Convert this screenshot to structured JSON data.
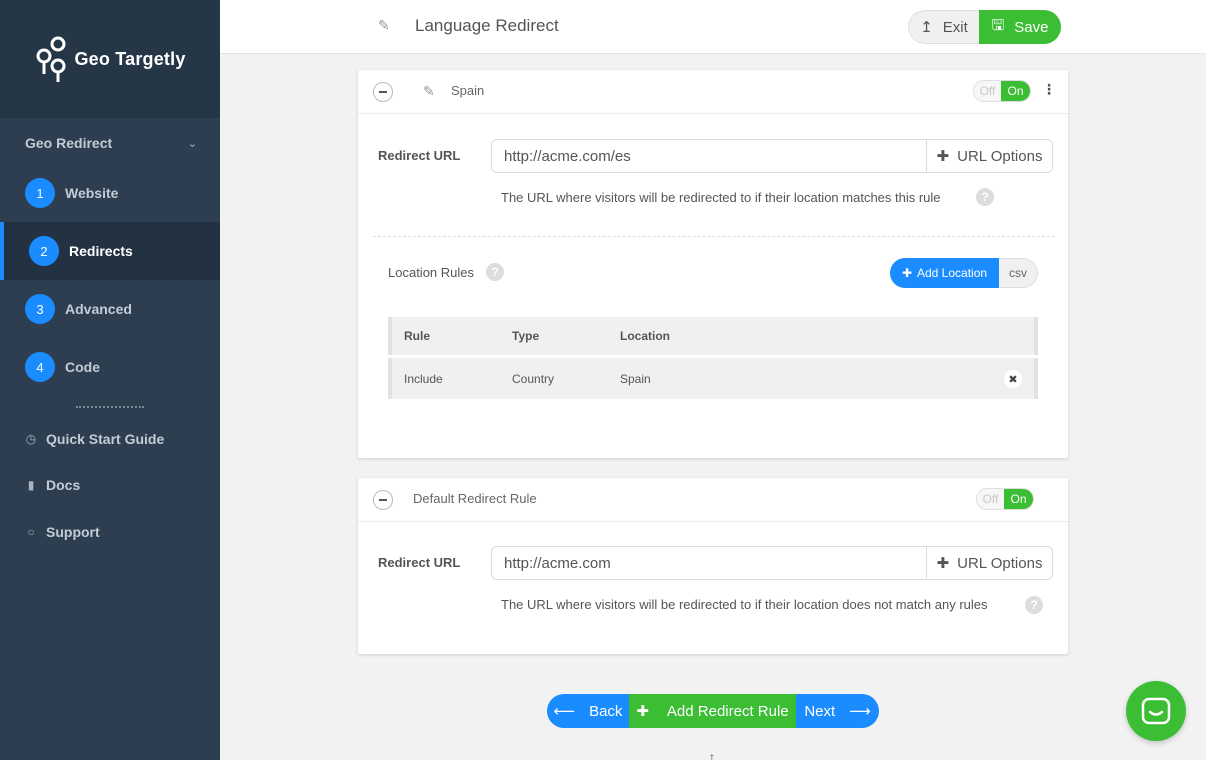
{
  "brand": {
    "name": "Geo Targetly"
  },
  "sidebar": {
    "section_title": "Geo Redirect",
    "steps": [
      {
        "num": "1",
        "label": "Website"
      },
      {
        "num": "2",
        "label": "Redirects"
      },
      {
        "num": "3",
        "label": "Advanced"
      },
      {
        "num": "4",
        "label": "Code"
      }
    ],
    "links": [
      {
        "label": "Quick Start Guide",
        "icon": "clock-icon"
      },
      {
        "label": "Docs",
        "icon": "book-icon"
      },
      {
        "label": "Support",
        "icon": "chat-bubble-icon"
      }
    ]
  },
  "header": {
    "title": "Language Redirect",
    "exit_label": "Exit",
    "save_label": "Save"
  },
  "rule_card": {
    "name": "Spain",
    "toggle_off": "Off",
    "toggle_on": "On",
    "redirect_url_label": "Redirect URL",
    "redirect_url_value": "http://acme.com/es",
    "url_options_label": "URL Options",
    "help_text": "The URL where visitors will be redirected to if their location matches this rule",
    "location_rules_title": "Location Rules",
    "add_location_label": "Add Location",
    "csv_label": "csv",
    "table": {
      "headers": [
        "Rule",
        "Type",
        "Location"
      ],
      "rows": [
        {
          "rule": "Include",
          "type": "Country",
          "location": "Spain"
        }
      ]
    }
  },
  "default_card": {
    "name": "Default Redirect Rule",
    "toggle_off": "Off",
    "toggle_on": "On",
    "redirect_url_label": "Redirect URL",
    "redirect_url_value": "http://acme.com",
    "url_options_label": "URL Options",
    "help_text": "The URL where visitors will be redirected to if their location does not match any rules"
  },
  "bottom_nav": {
    "back_label": "Back",
    "add_rule_label": "Add Redirect Rule",
    "next_label": "Next"
  },
  "colors": {
    "sidebar_bg": "#2c3e50",
    "primary_blue": "#1a8cff",
    "success_green": "#3bbd34"
  }
}
